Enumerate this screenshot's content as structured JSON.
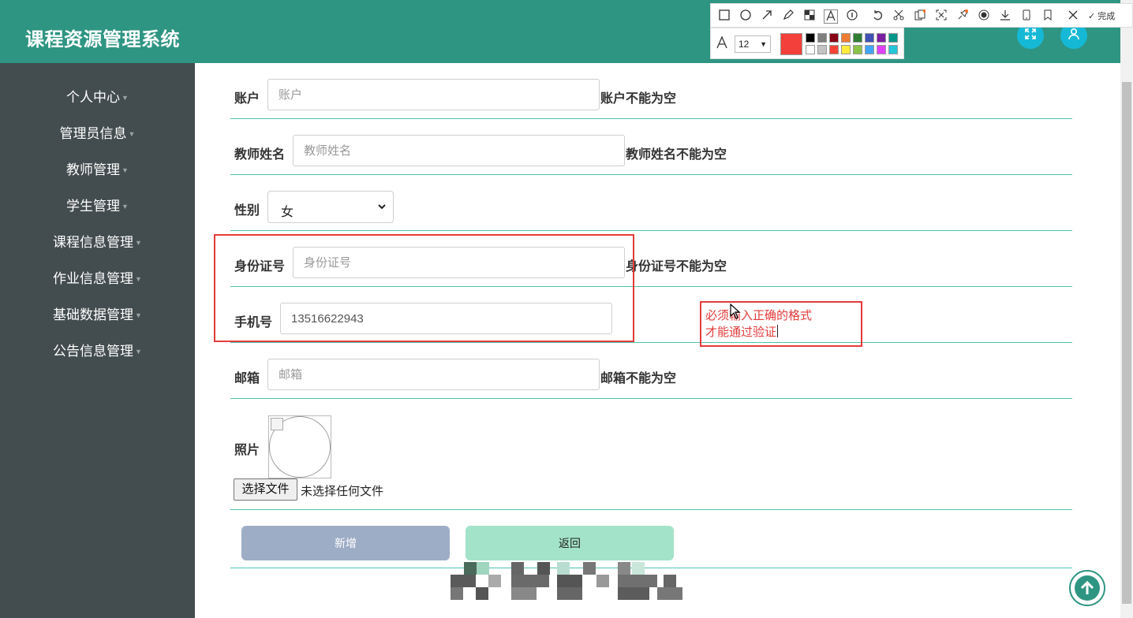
{
  "header": {
    "title": "课程资源管理系统"
  },
  "sidebar": {
    "items": [
      {
        "label": "个人中心"
      },
      {
        "label": "管理员信息"
      },
      {
        "label": "教师管理"
      },
      {
        "label": "学生管理"
      },
      {
        "label": "课程信息管理"
      },
      {
        "label": "作业信息管理"
      },
      {
        "label": "基础数据管理"
      },
      {
        "label": "公告信息管理"
      }
    ]
  },
  "form": {
    "account": {
      "label": "账户",
      "placeholder": "账户",
      "hint": "账户不能为空"
    },
    "teacher_name": {
      "label": "教师姓名",
      "placeholder": "教师姓名",
      "hint": "教师姓名不能为空"
    },
    "gender": {
      "label": "性别",
      "value": "女"
    },
    "id_card": {
      "label": "身份证号",
      "placeholder": "身份证号",
      "hint": "身份证号不能为空"
    },
    "phone": {
      "label": "手机号",
      "value": "13516622943"
    },
    "email": {
      "label": "邮箱",
      "placeholder": "邮箱",
      "hint": "邮箱不能为空"
    },
    "photo": {
      "label": "照片",
      "file_button": "选择文件",
      "file_status": "未选择任何文件"
    },
    "buttons": {
      "add": "新增",
      "back": "返回"
    }
  },
  "annotation": {
    "line1": "必须输入正确的格式",
    "line2": "才能通过验证",
    "color": "#e23b3b"
  },
  "screenshot_toolbar": {
    "done_label": "完成",
    "font_size": "12",
    "current_color": "#f4403a",
    "palette": [
      "#000000",
      "#7f7f7f",
      "#880015",
      "#ed7d31",
      "#2e7d32",
      "#3f51b5",
      "#7b1fa2",
      "#009688",
      "#ffffff",
      "#c3c3c3",
      "#f44336",
      "#ffeb3b",
      "#8bc34a",
      "#42a5f5",
      "#e040fb",
      "#26c6da"
    ]
  },
  "colors": {
    "topbar": "#2f9583",
    "sidebar": "#434c4f",
    "row_line": "#4fc2b2",
    "add_button": "#9eadc6",
    "back_button": "#a3e3c9"
  }
}
